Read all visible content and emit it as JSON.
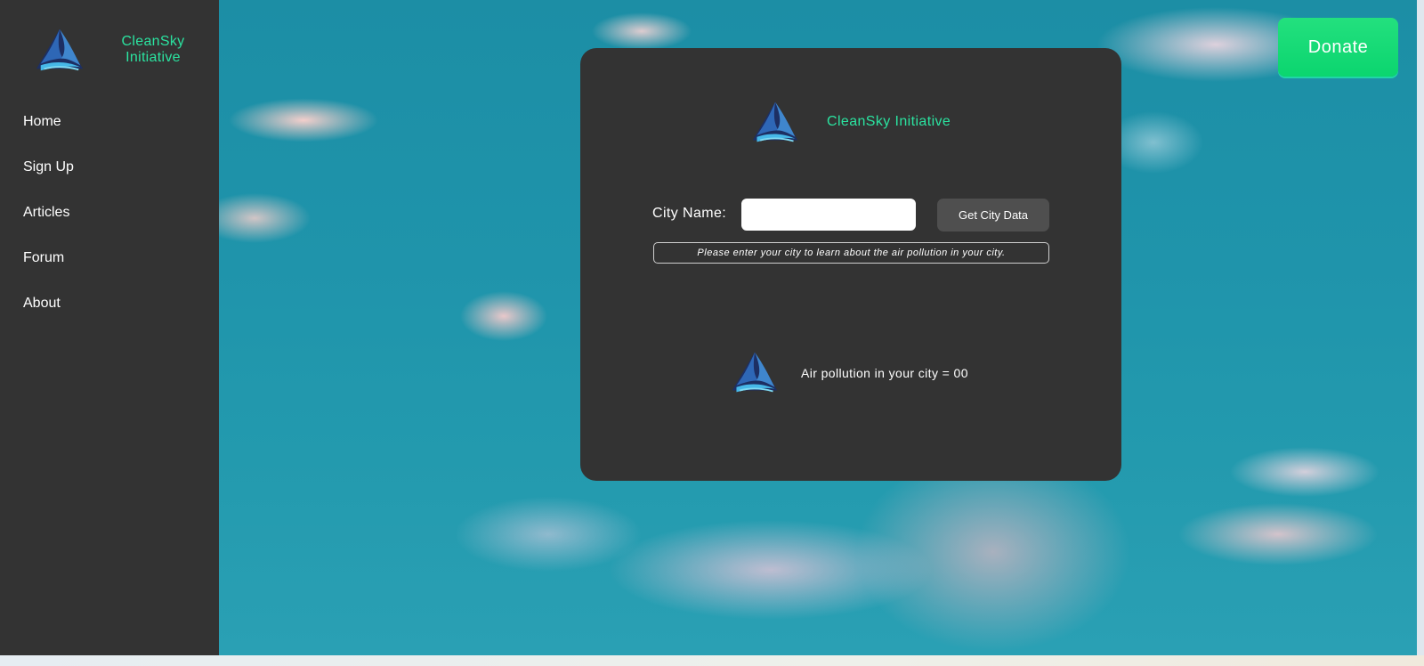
{
  "sidebar": {
    "brand": "CleanSky\nInitiative",
    "nav": [
      {
        "label": "Home"
      },
      {
        "label": "Sign Up"
      },
      {
        "label": "Articles"
      },
      {
        "label": "Forum"
      },
      {
        "label": "About"
      }
    ]
  },
  "header": {
    "donate_label": "Donate"
  },
  "card": {
    "brand": "CleanSky Initiative",
    "city_label": "City Name:",
    "city_value": "",
    "button_label": "Get City Data",
    "hint": "Please enter your city to learn about the air pollution in your city.",
    "result": "Air pollution in your city = 00"
  },
  "icons": {
    "logo": "triangle-swirl-logo-icon"
  },
  "colors": {
    "brand_text": "#2be3a0",
    "sidebar_bg": "#333333",
    "card_bg": "#333333",
    "donate_bg": "#14d977",
    "button_bg": "#4f4f4f"
  }
}
